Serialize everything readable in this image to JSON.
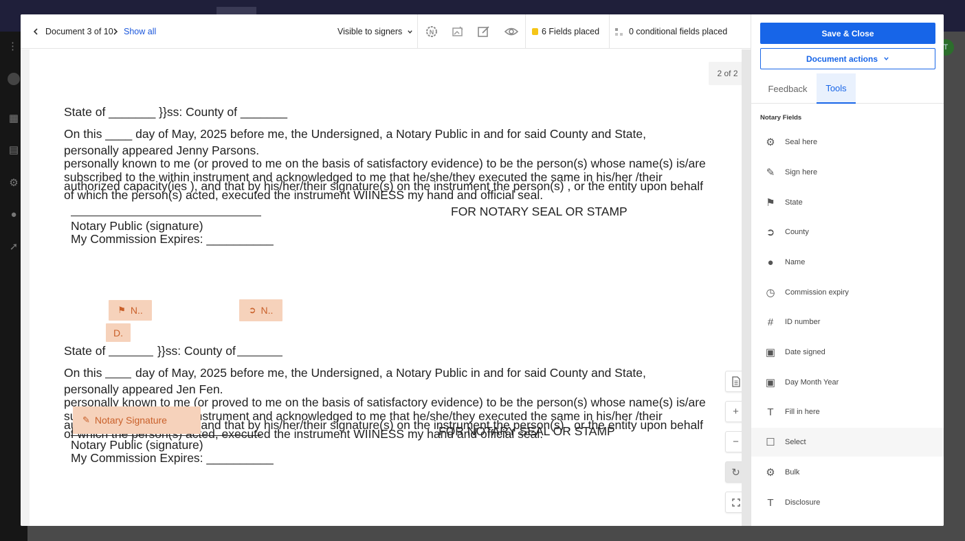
{
  "toolbar": {
    "doc_counter": "Document 3 of 10",
    "show_all": "Show all",
    "visibility": "Visible to signers",
    "fields_placed": "6 Fields placed",
    "conditional_fields": "0 conditional fields placed"
  },
  "colors": {
    "accent": "#1765e8",
    "chip_bg": "#f6d2bb",
    "chip_text": "#c9602a",
    "fields_dot": "#f5c518"
  },
  "document": {
    "page_counter": "2 of 2",
    "section1": {
      "state_line": "State of _______ }}ss: County of _______",
      "day_line": "On this ____ day of May, 2025 before me, the Undersigned, a Notary Public in and for said County and State,",
      "appeared": "personally appeared Jenny Parsons.",
      "known": "personally known to me (or proved to me on the basis of satisfactory evidence) to be the person(s) whose name(s) is/are",
      "subscribed": "subscribed to the within instrument and acknowledged to me that he/she/they executed the same in his/her /their",
      "authorized": "authorized  capacity(ies ), and that by his/her/their signature(s) on the instrument the person(s) , or the entity upon behalf",
      "witness": "of which the person(s) acted, executed the instrument WIINESS my hand and official seal.",
      "seal": "FOR NOTARY SEAL OR STAMP",
      "notary_sig": "Notary Public (signature)",
      "expires": "My Commission Expires: __________"
    },
    "section2": {
      "state_prefix": "State of",
      "ss_county": "}}ss: County of",
      "day_prefix": "On this",
      "day_rest": "day of May, 2025 before me, the Undersigned, a Notary Public in and for said County and State,",
      "appeared": "personally appeared Jen Fen.",
      "known": "personally known to me (or proved to me on the basis of satisfactory evidence) to be the person(s) whose name(s) is/are",
      "subscribed": "subscribed to the within instrument and acknowledged to me that he/she/they executed the same in his/her /their",
      "authorized": "authorized  capacity(ies ), and that by his/her/their signature(s) on the instrument the person(s) , or the entity upon behalf",
      "witness": "of which the person(s) acted, executed the instrument WIINESS my hand and official seal.",
      "seal": "FOR NOTARY SEAL OR STAMP",
      "notary_sig": "Notary Public (signature)",
      "expires": "My Commission Expires: __________"
    },
    "fields": {
      "state_chip": "N..",
      "county_chip": "N..",
      "day_chip": "D.",
      "signature_chip": "Notary Signature"
    }
  },
  "panel": {
    "save_close": "Save & Close",
    "document_actions": "Document actions",
    "tab_feedback": "Feedback",
    "tab_tools": "Tools",
    "section_title": "Notary Fields",
    "tools": [
      {
        "label": "Seal here",
        "icon": "seal-icon"
      },
      {
        "label": "Sign here",
        "icon": "pen-icon"
      },
      {
        "label": "State",
        "icon": "flag-icon"
      },
      {
        "label": "County",
        "icon": "compass-icon"
      },
      {
        "label": "Name",
        "icon": "person-icon"
      },
      {
        "label": "Commission expiry",
        "icon": "clock-icon"
      },
      {
        "label": "ID number",
        "icon": "hash-icon"
      },
      {
        "label": "Date signed",
        "icon": "calendar-icon"
      },
      {
        "label": "Day Month Year",
        "icon": "calendar-icon"
      },
      {
        "label": "Fill in here",
        "icon": "text-box-icon"
      },
      {
        "label": "Select",
        "icon": "checkbox-icon"
      },
      {
        "label": "Bulk",
        "icon": "gear-icon"
      },
      {
        "label": "Disclosure",
        "icon": "text-box-icon"
      }
    ]
  }
}
